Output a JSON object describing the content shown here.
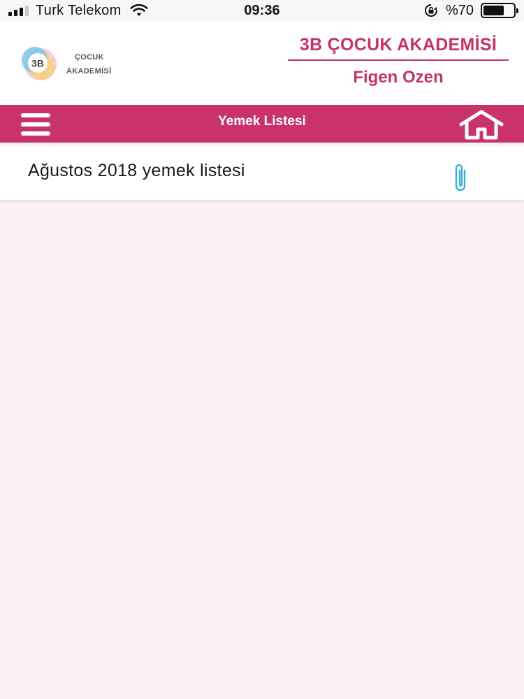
{
  "status_bar": {
    "carrier": "Turk Telekom",
    "time": "09:36",
    "battery_text": "%70",
    "battery_level": 0.7,
    "signal_bars_active": 3,
    "signal_bars_total": 4
  },
  "header": {
    "logo_badge": "3B",
    "logo_line1": "ÇOCUK",
    "logo_line2": "AKADEMİSİ",
    "brand_title": "3B ÇOCUK AKADEMİSİ",
    "user_name": "Figen Ozen"
  },
  "navbar": {
    "title": "Yemek Listesi",
    "menu_icon": "hamburger-menu-icon",
    "home_icon": "home-icon"
  },
  "list": {
    "items": [
      {
        "label": "Ağustos 2018 yemek listesi",
        "icon": "paperclip-icon"
      }
    ]
  },
  "colors": {
    "accent": "#c8336c",
    "background": "#fbf1f4",
    "attachment": "#3ab0d6"
  }
}
